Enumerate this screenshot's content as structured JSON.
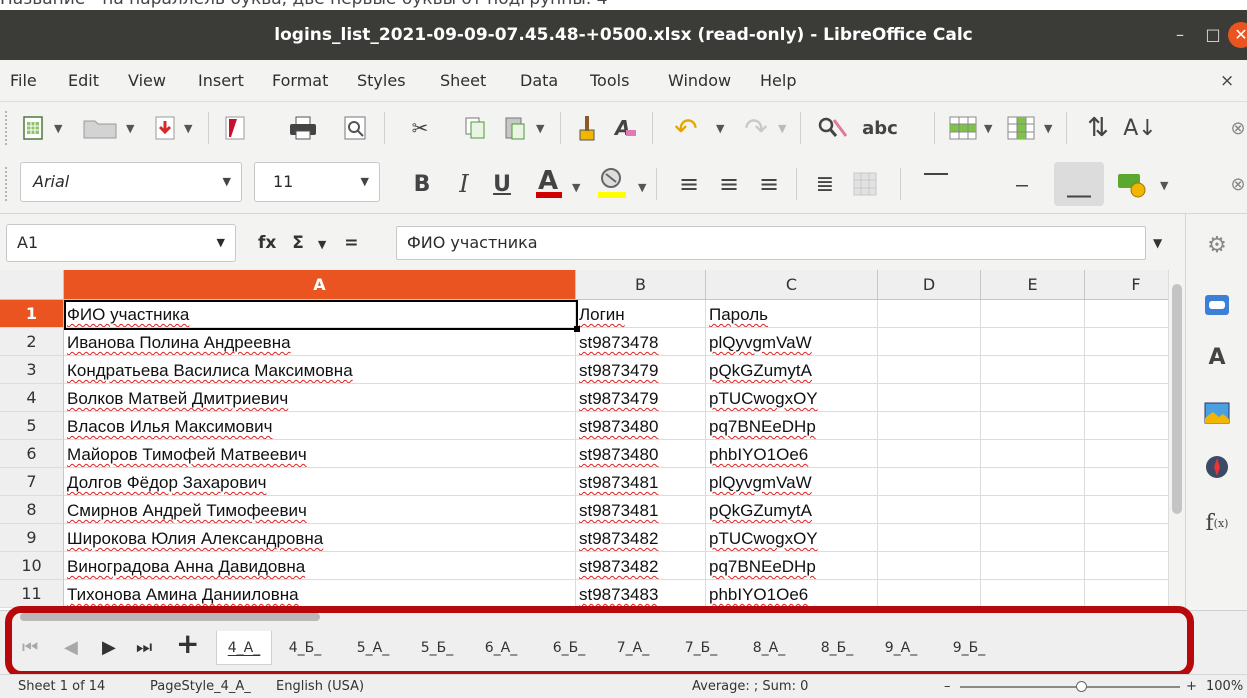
{
  "caption_fragment": "Название - на параллель буква, две первые буквы от подгруппы. 4",
  "window": {
    "title": "logins_list_2021-09-09-07.45.48-+0500.xlsx (read-only) - LibreOffice Calc",
    "minimize": "–",
    "maximize": "□",
    "close": "✕"
  },
  "menubar": {
    "items": [
      "File",
      "Edit",
      "View",
      "Insert",
      "Format",
      "Styles",
      "Sheet",
      "Data",
      "Tools",
      "Window",
      "Help"
    ],
    "close_doc": "×"
  },
  "toolbar2": {
    "font_name": "Arial",
    "font_size": "11",
    "bold": "B",
    "italic": "I",
    "underline": "U"
  },
  "formula_bar": {
    "cell_ref": "A1",
    "fx": "fx",
    "sum": "Σ",
    "equals": "=",
    "content": "ФИО участника"
  },
  "sheet": {
    "columns": [
      "A",
      "B",
      "C",
      "D",
      "E",
      "F"
    ],
    "active_column": "A",
    "active_row": "1",
    "rows": [
      {
        "num": "1",
        "cells": [
          "ФИО участника",
          "Логин",
          "Пароль"
        ]
      },
      {
        "num": "2",
        "cells": [
          "Иванова Полина Андреевна",
          "st9873478",
          "plQyvgmVaW"
        ]
      },
      {
        "num": "3",
        "cells": [
          "Кондратьева Василиса Максимовна",
          "st9873479",
          "pQkGZumytA"
        ]
      },
      {
        "num": "4",
        "cells": [
          "Волков Матвей Дмитриевич",
          "st9873479",
          "pTUCwogxOY"
        ]
      },
      {
        "num": "5",
        "cells": [
          "Власов Илья Максимович",
          "st9873480",
          "pq7BNEeDHp"
        ]
      },
      {
        "num": "6",
        "cells": [
          "Майоров Тимофей Матвеевич",
          "st9873480",
          "phbIYO1Oe6"
        ]
      },
      {
        "num": "7",
        "cells": [
          "Долгов Фёдор Захарович",
          "st9873481",
          "plQyvgmVaW"
        ]
      },
      {
        "num": "8",
        "cells": [
          "Смирнов Андрей Тимофеевич",
          "st9873481",
          "pQkGZumytA"
        ]
      },
      {
        "num": "9",
        "cells": [
          "Широкова Юлия Александровна",
          "st9873482",
          "pTUCwogxOY"
        ]
      },
      {
        "num": "10",
        "cells": [
          "Виноградова Анна Давидовна",
          "st9873482",
          "pq7BNEeDHp"
        ]
      },
      {
        "num": "11",
        "cells": [
          "Тихонова Амина Данииловна",
          "st9873483",
          "phbIYO1Oe6"
        ]
      }
    ]
  },
  "sheet_tabs": {
    "add": "+",
    "active": "4_А_",
    "tabs": [
      "4_А_",
      "4_Б_",
      "5_А_",
      "5_Б_",
      "6_А_",
      "6_Б_",
      "7_А_",
      "7_Б_",
      "8_А_",
      "8_Б_",
      "9_А_",
      "9_Б_"
    ]
  },
  "status": {
    "sheet": "Sheet 1 of 14",
    "page_style": "PageStyle_4_А_",
    "language": "English (USA)",
    "summary": "Average: ; Sum: 0",
    "zoom": "100%",
    "zoom_minus": "–",
    "zoom_plus": "+"
  },
  "colors": {
    "accent": "#e95420",
    "titlebar": "#3b3b38",
    "highlight_frame": "#b7080c"
  }
}
